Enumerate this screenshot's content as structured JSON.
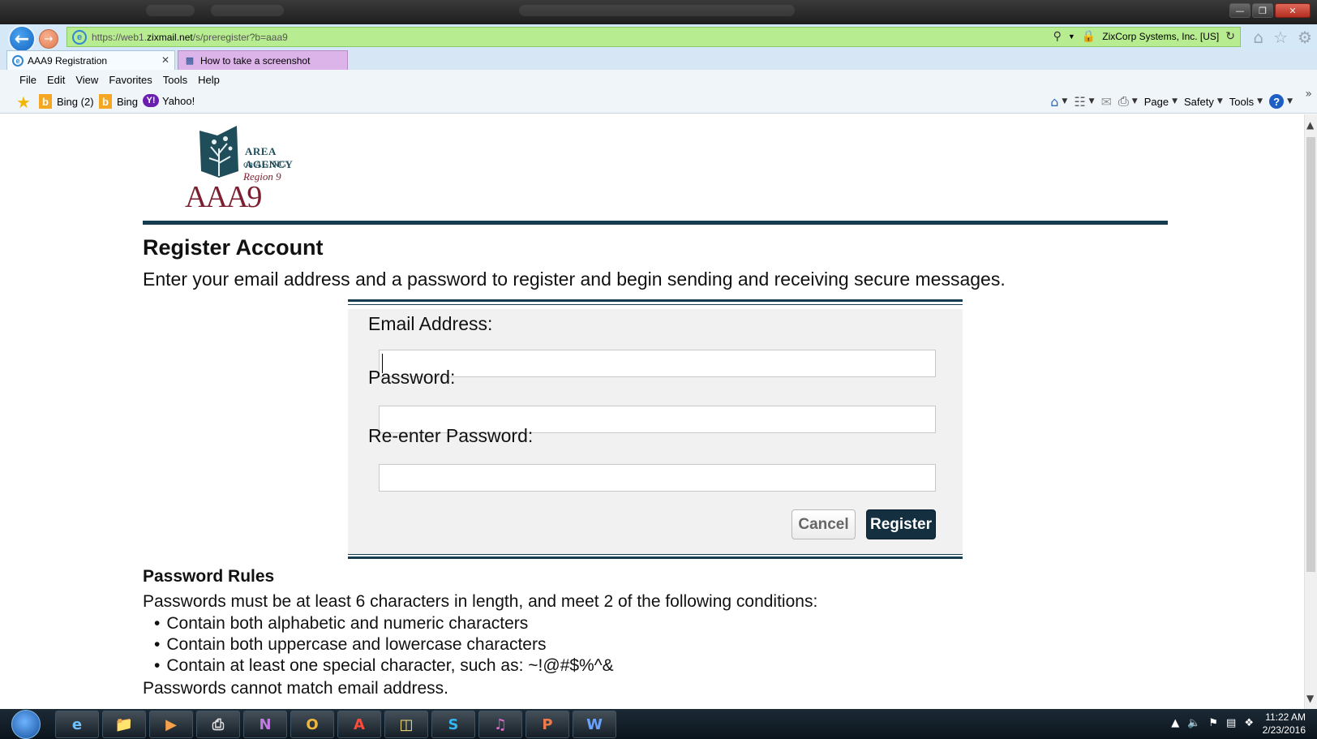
{
  "browser": {
    "url_prefix": "https://web1.",
    "url_domain": "zixmail.net",
    "url_path": "/s/preregister?b=aaa9",
    "site_identity": "ZixCorp Systems, Inc. [US]",
    "tabs": [
      {
        "label": "AAA9 Registration",
        "active": true
      },
      {
        "label": "How to take a screenshot",
        "active": false
      }
    ],
    "menu": [
      "File",
      "Edit",
      "View",
      "Favorites",
      "Tools",
      "Help"
    ],
    "favorites": [
      {
        "label": "Bing (2)",
        "icon": "bing-icon"
      },
      {
        "label": "Bing",
        "icon": "bing-icon"
      },
      {
        "label": "Yahoo!",
        "icon": "yahoo-icon"
      }
    ],
    "command_bar": {
      "page": "Page",
      "safety": "Safety",
      "tools": "Tools"
    }
  },
  "logo": {
    "line1": "AREA AGENCY",
    "line2": "on AGING",
    "line3": "Region 9",
    "acronym": "AAA9"
  },
  "page": {
    "title": "Register Account",
    "subtitle": "Enter your email address and a password to register and begin sending and receiving secure messages."
  },
  "form": {
    "email_label": "Email Address:",
    "email_value": "",
    "password_label": "Password:",
    "password_value": "",
    "reenter_label": "Re-enter Password:",
    "reenter_value": "",
    "cancel_label": "Cancel",
    "register_label": "Register"
  },
  "rules": {
    "title": "Password Rules",
    "intro": "Passwords must be at least 6 characters in length, and meet 2 of the following conditions:",
    "items": [
      "Contain both alphabetic and numeric characters",
      "Contain both uppercase and lowercase characters",
      "Contain at least one special character, such as: ~!@#$%^&"
    ],
    "footer": "Passwords cannot match email address."
  },
  "taskbar": {
    "time": "11:22 AM",
    "date": "2/23/2016"
  },
  "colors": {
    "brand_navy": "#163c50",
    "register_button": "#132f40",
    "url_bar_green": "#b8ec90"
  }
}
